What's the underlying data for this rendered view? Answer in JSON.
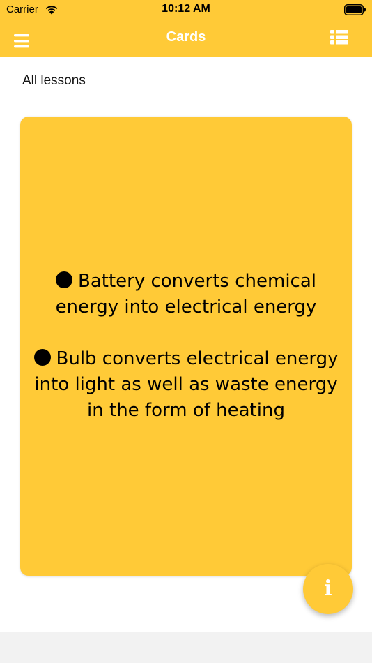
{
  "status_bar": {
    "carrier": "Carrier",
    "time": "10:12 AM",
    "wifi_icon": "wifi-icon",
    "battery_icon": "battery-icon"
  },
  "nav": {
    "title": "Cards",
    "menu_icon": "hamburger-menu-icon",
    "list_icon": "list-view-icon"
  },
  "breadcrumb": "All lessons",
  "card": {
    "paragraphs": [
      "Battery converts chemical energy into electrical energy",
      "Bulb converts electrical energy into light as well as waste energy in the form of heating"
    ]
  },
  "fab": {
    "info_label": "i",
    "icon": "info-icon"
  },
  "colors": {
    "accent": "#FFCA37",
    "nav_text": "#FFFFFF",
    "bottom_bar": "#F2F2F2"
  }
}
